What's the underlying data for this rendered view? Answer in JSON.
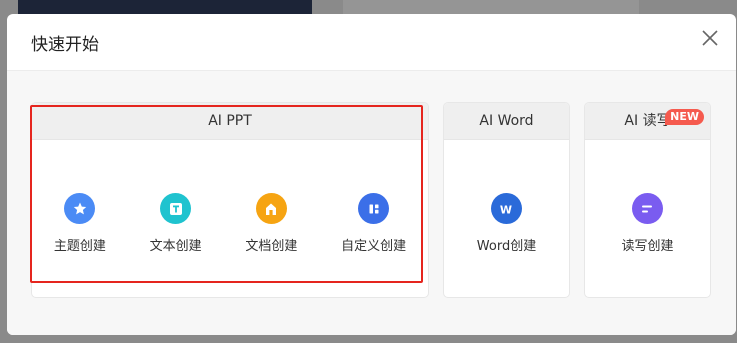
{
  "dialog": {
    "title": "快速开始"
  },
  "cards": {
    "ppt": {
      "header": "AI PPT",
      "items": [
        {
          "label": "主题创建",
          "icon": "star-icon",
          "color": "#4b8bf5"
        },
        {
          "label": "文本创建",
          "icon": "text-icon",
          "color": "#1fc3cf"
        },
        {
          "label": "文档创建",
          "icon": "house-doc-icon",
          "color": "#f6a412"
        },
        {
          "label": "自定义创建",
          "icon": "layout-icon",
          "color": "#3b6fe8"
        }
      ]
    },
    "word": {
      "header": "AI Word",
      "items": [
        {
          "label": "Word创建",
          "icon": "word-icon",
          "color": "#2a6ad9"
        }
      ]
    },
    "readwrite": {
      "header": "AI 读写",
      "badge": "NEW",
      "items": [
        {
          "label": "读写创建",
          "icon": "readwrite-icon",
          "color": "#7a5cf0"
        }
      ]
    }
  },
  "colors": {
    "highlight": "#e5251e",
    "badge": "#f55a4e"
  }
}
